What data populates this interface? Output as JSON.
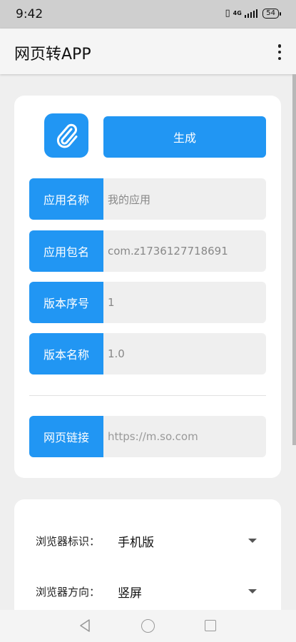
{
  "status_bar": {
    "time": "9:42",
    "network": "4G",
    "battery": "54"
  },
  "app_bar": {
    "title": "网页转APP",
    "menu_icon": "more-vert-icon"
  },
  "form": {
    "logo_icon": "paperclip-icon",
    "generate_label": "生成",
    "fields": [
      {
        "label": "应用名称",
        "value": "我的应用"
      },
      {
        "label": "应用包名",
        "value": "com.z1736127718691"
      },
      {
        "label": "版本序号",
        "value": "1"
      },
      {
        "label": "版本名称",
        "value": "1.0"
      }
    ],
    "url_field": {
      "label": "网页链接",
      "placeholder": "https://m.so.com"
    }
  },
  "settings": {
    "user_agent": {
      "label": "浏览器标识：",
      "value": "手机版"
    },
    "orientation": {
      "label": "浏览器方向：",
      "value": "竖屏"
    }
  },
  "colors": {
    "accent": "#2196f3",
    "background": "#efefef",
    "card": "#ffffff"
  }
}
